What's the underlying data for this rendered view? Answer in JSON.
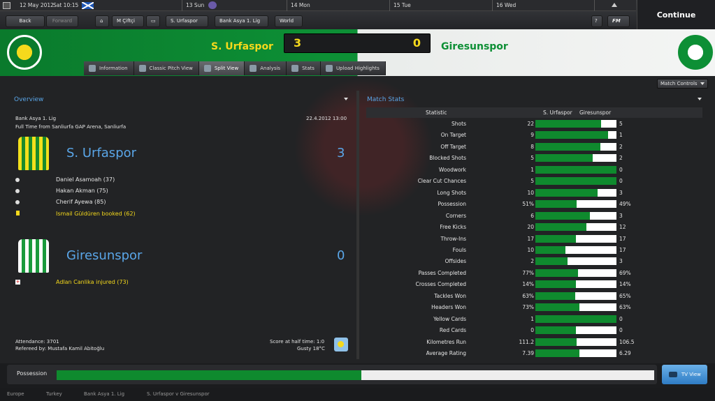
{
  "topbar": {
    "date": "12 May 2012",
    "time_label": "Sat 10:15",
    "days": [
      "13 Sun",
      "14 Mon",
      "15 Tue",
      "16 Wed"
    ],
    "continue": "Continue"
  },
  "toolbar": {
    "back": "Back",
    "forward": "Forward",
    "manager": "M Çiftçi",
    "club": "S. Urfaspor",
    "league": "Bank Asya 1. Lig",
    "world": "World",
    "fm": "FM"
  },
  "match": {
    "home": "S. Urfaspor",
    "away": "Giresunspor",
    "home_score": "3",
    "away_score": "0"
  },
  "tabs": [
    "Information",
    "Classic Pitch View",
    "Split View",
    "Analysis",
    "Stats",
    "Upload Highlights"
  ],
  "overview": {
    "title": "Overview",
    "competition": "Bank Asya 1. Lig",
    "venue": "Full Time from Sanliurfa GAP Arena, Sanliurfa",
    "datetime": "22.4.2012 13:00",
    "home": {
      "name": "S. Urfaspor",
      "score": "3",
      "events": [
        "Daniel Asamoah (37)",
        "Hakan Akman (75)",
        "Cherif Ayewa (85)",
        "Ismail Güldüren booked (62)"
      ]
    },
    "away": {
      "name": "Giresunspor",
      "score": "0",
      "events": [
        "Adlan Canlika injured (73)"
      ]
    },
    "attendance": "Attendance: 3701",
    "referee": "Refereed by: Mustafa Kamil Abitoğlu",
    "halftime": "Score at half time: 1:0",
    "weather": "Gusty 18°C"
  },
  "match_controls": "Match Controls",
  "stats": {
    "title": "Match Stats",
    "col_stat": "Statistic",
    "col_home": "S. Urfaspor",
    "col_away": "Giresunspor",
    "rows": [
      {
        "label": "Shots",
        "home": "22",
        "away": "5",
        "share": 0.81
      },
      {
        "label": "On Target",
        "home": "9",
        "away": "1",
        "share": 0.9
      },
      {
        "label": "Off Target",
        "home": "8",
        "away": "2",
        "share": 0.8
      },
      {
        "label": "Blocked Shots",
        "home": "5",
        "away": "2",
        "share": 0.71
      },
      {
        "label": "Woodwork",
        "home": "1",
        "away": "0",
        "share": 1.0
      },
      {
        "label": "Clear Cut Chances",
        "home": "5",
        "away": "0",
        "share": 1.0
      },
      {
        "label": "Long Shots",
        "home": "10",
        "away": "3",
        "share": 0.77
      },
      {
        "label": "Possession",
        "home": "51%",
        "away": "49%",
        "share": 0.51
      },
      {
        "label": "Corners",
        "home": "6",
        "away": "3",
        "share": 0.67
      },
      {
        "label": "Free Kicks",
        "home": "20",
        "away": "12",
        "share": 0.63
      },
      {
        "label": "Throw-Ins",
        "home": "17",
        "away": "17",
        "share": 0.5
      },
      {
        "label": "Fouls",
        "home": "10",
        "away": "17",
        "share": 0.37
      },
      {
        "label": "Offsides",
        "home": "2",
        "away": "3",
        "share": 0.4
      },
      {
        "label": "Passes Completed",
        "home": "77%",
        "away": "69%",
        "share": 0.53
      },
      {
        "label": "Crosses Completed",
        "home": "14%",
        "away": "14%",
        "share": 0.5
      },
      {
        "label": "Tackles Won",
        "home": "63%",
        "away": "65%",
        "share": 0.49
      },
      {
        "label": "Headers Won",
        "home": "73%",
        "away": "63%",
        "share": 0.54
      },
      {
        "label": "Yellow Cards",
        "home": "1",
        "away": "0",
        "share": 1.0
      },
      {
        "label": "Red Cards",
        "home": "0",
        "away": "0",
        "share": 0.5
      },
      {
        "label": "Kilometres Run",
        "home": "111.2",
        "away": "106.5",
        "share": 0.51
      },
      {
        "label": "Average Rating",
        "home": "7.39",
        "away": "6.29",
        "share": 0.54
      }
    ]
  },
  "possession": {
    "label": "Possession",
    "home_share": 0.51
  },
  "tv_view": "TV View",
  "breadcrumb": [
    "Europe",
    "Turkey",
    "Bank Asya 1. Lig",
    "S. Urfaspor v Giresunspor"
  ]
}
